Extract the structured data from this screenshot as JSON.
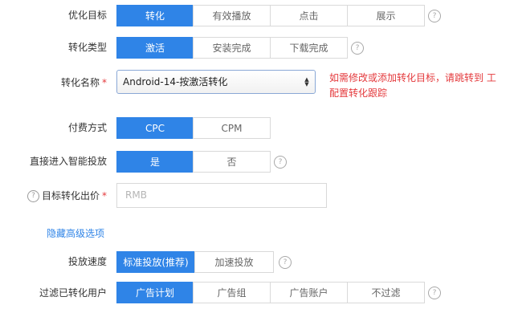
{
  "rows": {
    "optimize_target": {
      "label": "优化目标",
      "options": [
        "转化",
        "有效播放",
        "点击",
        "展示"
      ],
      "selected": 0
    },
    "conversion_type": {
      "label": "转化类型",
      "options": [
        "激活",
        "安装完成",
        "下载完成"
      ],
      "selected": 0
    },
    "conversion_name": {
      "label": "转化名称",
      "required_mark": "*",
      "value": "Android-14-按激活转化",
      "hint_line1": "如需修改或添加转化目标，请跳转到 工",
      "hint_line2": "配置转化跟踪"
    },
    "pay_method": {
      "label": "付费方式",
      "options": [
        "CPC",
        "CPM"
      ],
      "selected": 0
    },
    "smart_delivery": {
      "label": "直接进入智能投放",
      "options": [
        "是",
        "否"
      ],
      "selected": 0
    },
    "target_bid": {
      "label": "目标转化出价",
      "required_mark": "*",
      "placeholder": "RMB"
    },
    "advanced_toggle": "隐藏高级选项",
    "delivery_speed": {
      "label": "投放速度",
      "options": [
        "标准投放(推荐)",
        "加速投放"
      ],
      "selected": 0
    },
    "filter_converted": {
      "label": "过滤已转化用户",
      "options": [
        "广告计划",
        "广告组",
        "广告账户",
        "不过滤"
      ],
      "selected": 0
    }
  },
  "icons": {
    "help": "?"
  },
  "colors": {
    "accent": "#2f84e7",
    "required": "#e4393c"
  }
}
